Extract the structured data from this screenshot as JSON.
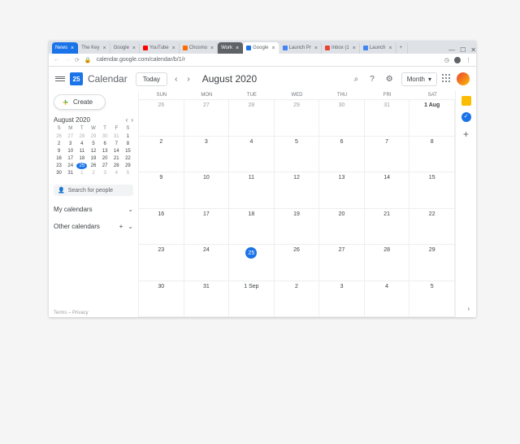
{
  "browser": {
    "tabs": [
      {
        "label": "News",
        "kind": "news"
      },
      {
        "label": "The Key",
        "kind": "normal"
      },
      {
        "label": "Google",
        "kind": "normal"
      },
      {
        "label": "YouTube",
        "kind": "normal",
        "favicon": "#ff0000"
      },
      {
        "label": "Chosmo",
        "kind": "normal",
        "favicon": "#ff6d00"
      },
      {
        "label": "Work",
        "kind": "group"
      },
      {
        "label": "Google",
        "kind": "active",
        "favicon": "#1a73e8"
      },
      {
        "label": "Launch Pr",
        "kind": "normal",
        "favicon": "#4285f4"
      },
      {
        "label": "Inbox (1",
        "kind": "normal",
        "favicon": "#ea4335"
      },
      {
        "label": "Launch",
        "kind": "normal",
        "favicon": "#4285f4"
      }
    ],
    "url": "calendar.google.com/calendar/b/1/r",
    "window_buttons": {
      "min": "—",
      "max": "☐",
      "close": "✕"
    }
  },
  "header": {
    "logo_day": "25",
    "app_name": "Calendar",
    "today": "Today",
    "month_title": "August 2020",
    "view": "Month"
  },
  "sidebar": {
    "create": "Create",
    "mini_month": "August 2020",
    "dow": [
      "S",
      "M",
      "T",
      "W",
      "T",
      "F",
      "S"
    ],
    "mini_days": [
      {
        "n": "26",
        "dim": true
      },
      {
        "n": "27",
        "dim": true
      },
      {
        "n": "28",
        "dim": true
      },
      {
        "n": "29",
        "dim": true
      },
      {
        "n": "30",
        "dim": true
      },
      {
        "n": "31",
        "dim": true
      },
      {
        "n": "1"
      },
      {
        "n": "2"
      },
      {
        "n": "3"
      },
      {
        "n": "4"
      },
      {
        "n": "5"
      },
      {
        "n": "6"
      },
      {
        "n": "7"
      },
      {
        "n": "8"
      },
      {
        "n": "9"
      },
      {
        "n": "10"
      },
      {
        "n": "11"
      },
      {
        "n": "12"
      },
      {
        "n": "13"
      },
      {
        "n": "14"
      },
      {
        "n": "15"
      },
      {
        "n": "16"
      },
      {
        "n": "17"
      },
      {
        "n": "18"
      },
      {
        "n": "19"
      },
      {
        "n": "20"
      },
      {
        "n": "21"
      },
      {
        "n": "22"
      },
      {
        "n": "23"
      },
      {
        "n": "24"
      },
      {
        "n": "25",
        "today": true
      },
      {
        "n": "26"
      },
      {
        "n": "27"
      },
      {
        "n": "28"
      },
      {
        "n": "29"
      },
      {
        "n": "30"
      },
      {
        "n": "31"
      },
      {
        "n": "1",
        "dim": true
      },
      {
        "n": "2",
        "dim": true
      },
      {
        "n": "3",
        "dim": true
      },
      {
        "n": "4",
        "dim": true
      },
      {
        "n": "5",
        "dim": true
      }
    ],
    "search_placeholder": "Search for people",
    "my_cal": "My calendars",
    "other_cal": "Other calendars",
    "footer": "Terms – Privacy"
  },
  "grid": {
    "dow": [
      "SUN",
      "MON",
      "TUE",
      "WED",
      "THU",
      "FRI",
      "SAT"
    ],
    "cells": [
      {
        "n": "26",
        "dim": true
      },
      {
        "n": "27",
        "dim": true
      },
      {
        "n": "28",
        "dim": true
      },
      {
        "n": "29",
        "dim": true
      },
      {
        "n": "30",
        "dim": true
      },
      {
        "n": "31",
        "dim": true
      },
      {
        "n": "1 Aug",
        "bold": true
      },
      {
        "n": "2"
      },
      {
        "n": "3"
      },
      {
        "n": "4"
      },
      {
        "n": "5"
      },
      {
        "n": "6"
      },
      {
        "n": "7"
      },
      {
        "n": "8"
      },
      {
        "n": "9"
      },
      {
        "n": "10"
      },
      {
        "n": "11"
      },
      {
        "n": "12"
      },
      {
        "n": "13"
      },
      {
        "n": "14"
      },
      {
        "n": "15"
      },
      {
        "n": "16"
      },
      {
        "n": "17"
      },
      {
        "n": "18"
      },
      {
        "n": "19"
      },
      {
        "n": "20"
      },
      {
        "n": "21"
      },
      {
        "n": "22"
      },
      {
        "n": "23"
      },
      {
        "n": "24"
      },
      {
        "n": "25",
        "today": true
      },
      {
        "n": "26"
      },
      {
        "n": "27"
      },
      {
        "n": "28"
      },
      {
        "n": "29"
      },
      {
        "n": "30"
      },
      {
        "n": "31"
      },
      {
        "n": "1 Sep"
      },
      {
        "n": "2"
      },
      {
        "n": "3"
      },
      {
        "n": "4"
      },
      {
        "n": "5"
      }
    ]
  }
}
